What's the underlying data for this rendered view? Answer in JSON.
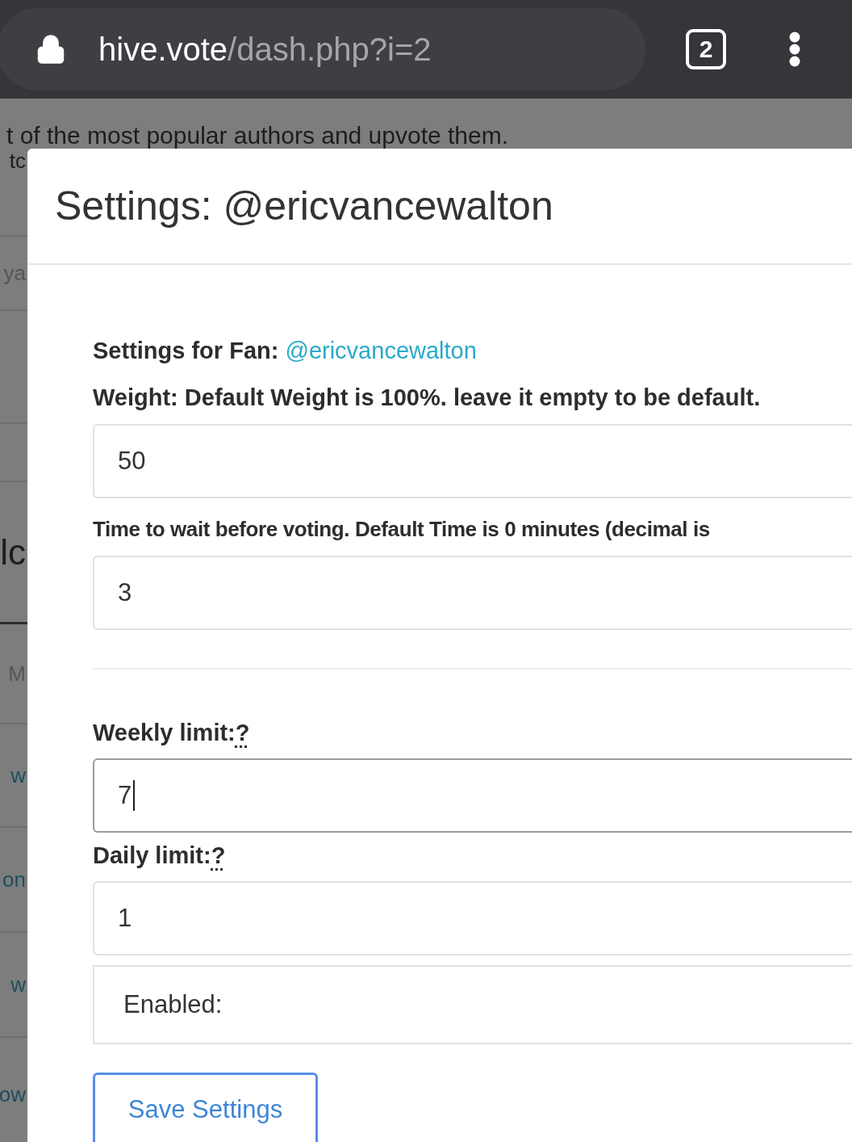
{
  "browser": {
    "url_host": "hive.vote",
    "url_path": "/dash.php?i=2",
    "tab_count": "2"
  },
  "background_page": {
    "line": "t of the most popular authors and upvote them.",
    "fragments": [
      {
        "text": "tc",
        "kind": "text"
      },
      {
        "text": "ya",
        "kind": "faded"
      },
      {
        "text": "lc",
        "kind": "heading"
      },
      {
        "text": "M",
        "kind": "faded"
      },
      {
        "text": "w",
        "kind": "link"
      },
      {
        "text": "on",
        "kind": "link"
      },
      {
        "text": "w",
        "kind": "link"
      },
      {
        "text": "ow",
        "kind": "link"
      }
    ]
  },
  "modal": {
    "title": "Settings: @ericvancewalton",
    "fan_label": "Settings for Fan:",
    "fan_name": "@ericvancewalton",
    "fields": [
      {
        "label": "Weight: Default Weight is 100%. leave it empty to be default.",
        "value": "50",
        "focused": false,
        "kind": "plain"
      },
      {
        "label": "Time to wait before voting. Default Time is 0 minutes (decimal is",
        "value": "3",
        "focused": false,
        "kind": "plain"
      },
      {
        "kind": "divider"
      },
      {
        "label": "Weekly limit:",
        "help": "?",
        "value": "7",
        "focused": true,
        "kind": "help"
      },
      {
        "label": "Daily limit:",
        "help": "?",
        "value": "1",
        "focused": false,
        "kind": "help"
      }
    ],
    "enabled_label": "Enabled:",
    "save_button": "Save Settings"
  }
}
